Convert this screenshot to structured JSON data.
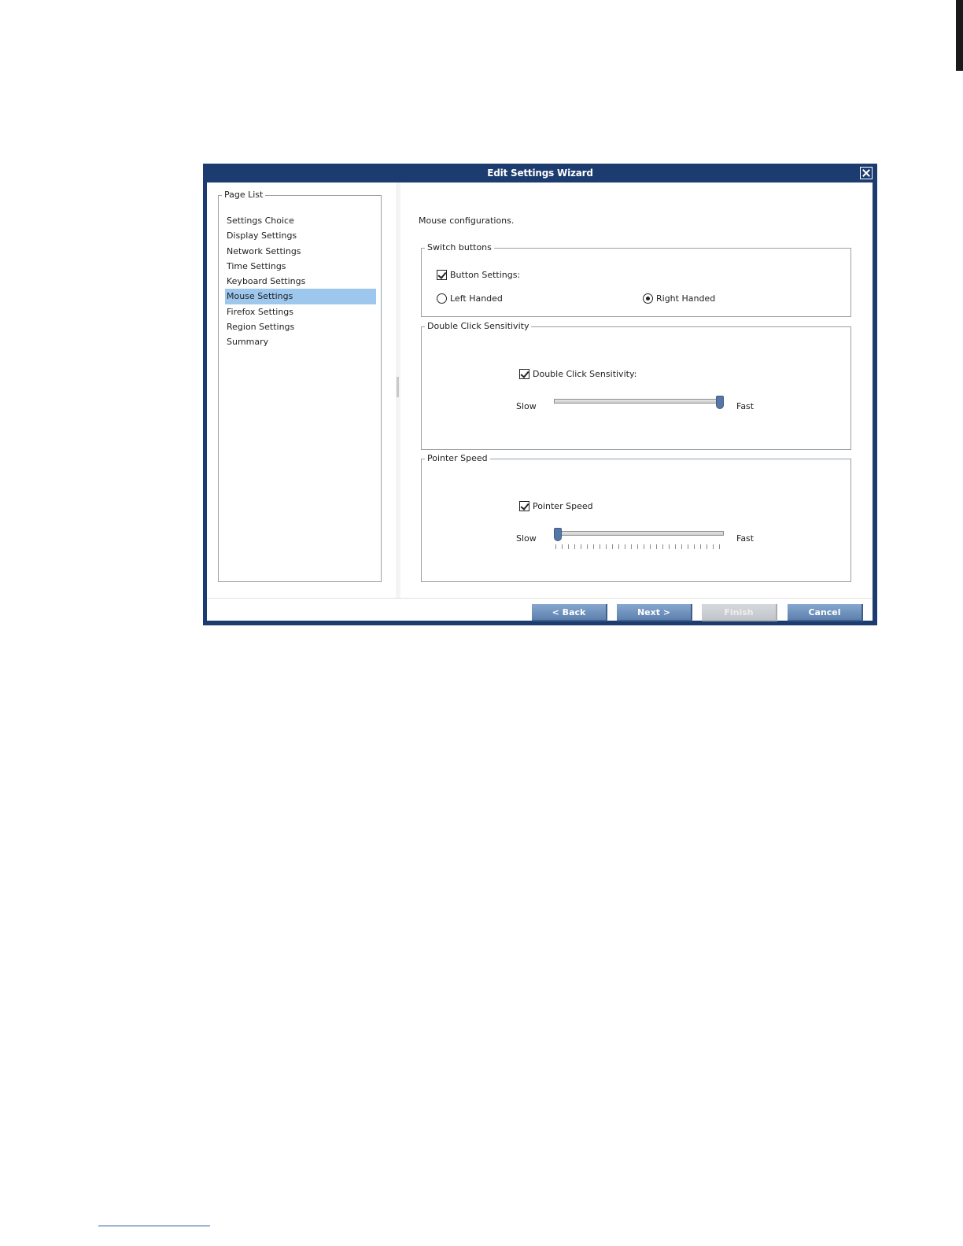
{
  "window": {
    "title": "Edit Settings Wizard",
    "close_icon": "close-icon"
  },
  "page_list": {
    "legend": "Page List",
    "items": [
      {
        "label": "Settings Choice",
        "selected": false
      },
      {
        "label": "Display Settings",
        "selected": false
      },
      {
        "label": "Network Settings",
        "selected": false
      },
      {
        "label": "Time Settings",
        "selected": false
      },
      {
        "label": "Keyboard Settings",
        "selected": false
      },
      {
        "label": "Mouse Settings",
        "selected": true
      },
      {
        "label": "Firefox Settings",
        "selected": false
      },
      {
        "label": "Region Settings",
        "selected": false
      },
      {
        "label": "Summary",
        "selected": false
      }
    ],
    "selection_color": "#9ec7ee"
  },
  "mouse": {
    "intro": "Mouse configurations.",
    "switch_buttons": {
      "legend": "Switch buttons",
      "button_settings_label": "Button Settings:",
      "button_settings_checked": true,
      "left_label": "Left Handed",
      "left_checked": false,
      "right_label": "Right Handed",
      "right_checked": true
    },
    "double_click": {
      "legend": "Double Click Sensitivity",
      "checkbox_label": "Double Click Sensitivity:",
      "checked": true,
      "slow_label": "Slow",
      "fast_label": "Fast",
      "value_fraction": 1.0
    },
    "pointer_speed": {
      "legend": "Pointer Speed",
      "checkbox_label": "Pointer Speed",
      "checked": true,
      "slow_label": "Slow",
      "fast_label": "Fast",
      "value_fraction": 0.0
    }
  },
  "footer": {
    "back_label": "< Back",
    "next_label": "Next >",
    "finish_label": "Finish",
    "finish_disabled": true,
    "cancel_label": "Cancel"
  },
  "colors": {
    "title_bar": "#1c3b6e",
    "button": "#6f93bf",
    "slider_thumb": "#5577a6"
  }
}
